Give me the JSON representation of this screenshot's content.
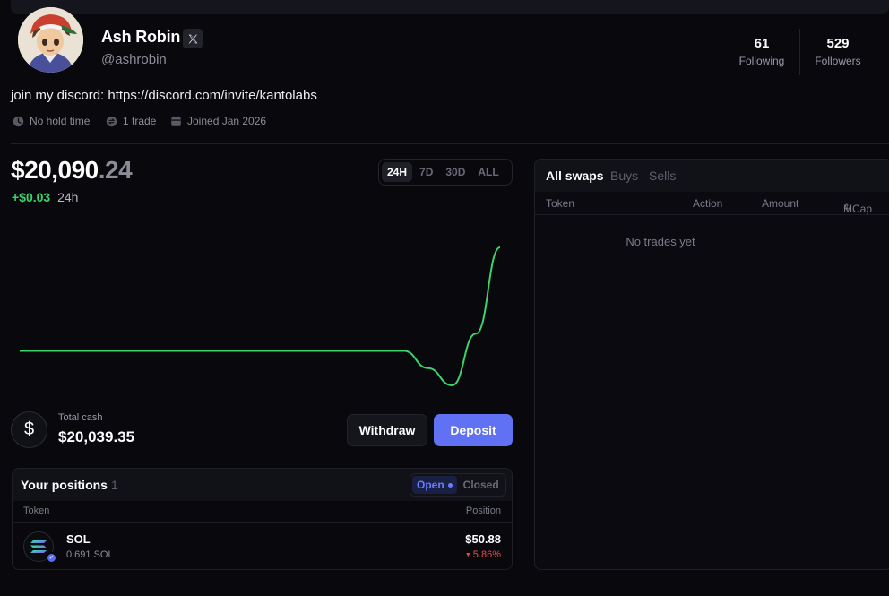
{
  "profile": {
    "name": "Ash Robin",
    "handle": "@ashrobin",
    "bio": "join my discord: https://discord.com/invite/kantolabs",
    "meta": {
      "hold_time": "No hold time",
      "trades": "1 trade",
      "joined": "Joined Jan 2026"
    },
    "stats": {
      "following_count": "61",
      "following_label": "Following",
      "followers_count": "529",
      "followers_label": "Followers"
    }
  },
  "portfolio": {
    "balance_main": "$20,090",
    "balance_cents": ".24",
    "change_value": "+$0.03",
    "change_period": "24h",
    "timeframes": [
      "24H",
      "7D",
      "30D",
      "ALL"
    ],
    "active_timeframe": "24H",
    "line_color": "#3dd26b"
  },
  "chart_data": {
    "type": "line",
    "x": [
      0,
      1,
      2,
      3,
      4,
      5,
      6,
      7,
      8,
      9,
      10,
      11,
      12,
      13,
      14,
      15,
      16,
      17,
      18,
      19,
      20
    ],
    "series": [
      {
        "values": [
          20090.21,
          20090.21,
          20090.21,
          20090.21,
          20090.21,
          20090.21,
          20090.21,
          20090.21,
          20090.21,
          20090.21,
          20090.21,
          20090.21,
          20090.21,
          20090.21,
          20090.21,
          20090.21,
          20090.21,
          20090.205,
          20090.2,
          20090.215,
          20090.24
        ]
      }
    ],
    "title": "",
    "xlabel": "",
    "ylabel": "",
    "grid": false
  },
  "cash": {
    "symbol": "$",
    "label": "Total cash",
    "value": "$20,039.35",
    "withdraw_label": "Withdraw",
    "deposit_label": "Deposit",
    "deposit_color": "#6072f3"
  },
  "positions": {
    "title": "Your positions",
    "count": "1",
    "toggle_open": "Open",
    "toggle_closed": "Closed",
    "col_token": "Token",
    "col_position": "Position",
    "rows": [
      {
        "symbol": "SOL",
        "amount": "0.691 SOL",
        "value": "$50.88",
        "change": "5.86%",
        "change_color": "#f0474c",
        "icon": "solana-icon"
      }
    ]
  },
  "swaps": {
    "tabs": [
      "All swaps",
      "Buys",
      "Sells"
    ],
    "columns": [
      "Token",
      "Action",
      "Amount",
      "MCap"
    ],
    "empty_text": "No trades yet"
  }
}
